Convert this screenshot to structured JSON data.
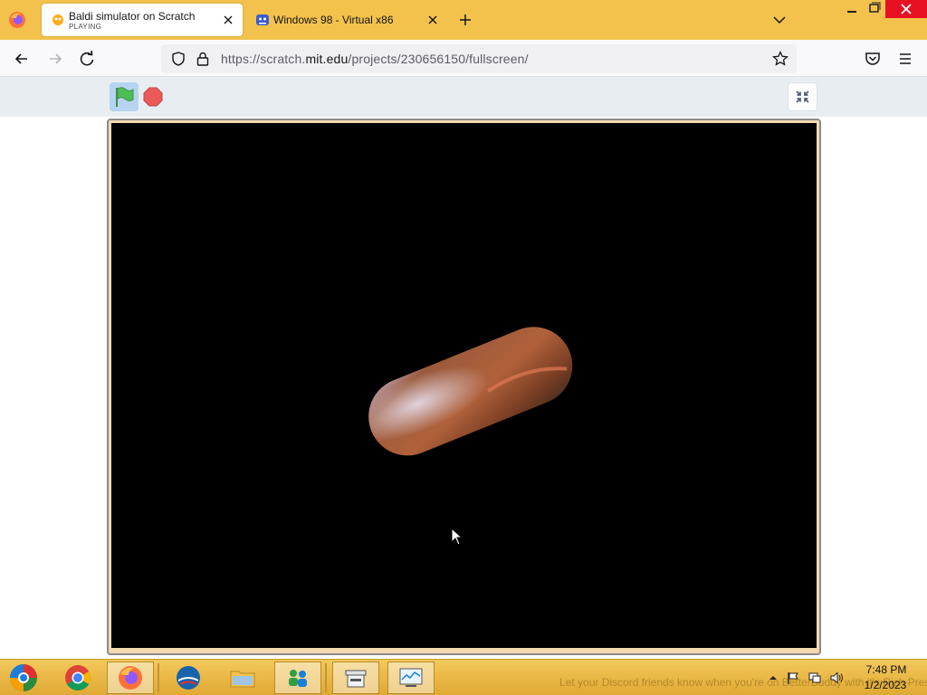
{
  "browser": {
    "tabs": [
      {
        "title": "Baldi simulator on Scratch",
        "subtitle": "PLAYING",
        "active": true
      },
      {
        "title": "Windows 98 - Virtual x86",
        "active": false
      }
    ],
    "url": {
      "prefix": "https://scratch.",
      "host": "mit.edu",
      "path": "/projects/230656150/fullscreen/"
    }
  },
  "taskbar": {
    "marquee": "Let your Discord friends know when you're on BetterBuddy with it's Rich Presence",
    "clock": {
      "time": "7:48 PM",
      "date": "1/2/2023"
    }
  },
  "colors": {
    "tabstrip": "#f2c24c",
    "stage": "#000000",
    "flag": "#4cbf56",
    "stop": "#ec5959"
  }
}
